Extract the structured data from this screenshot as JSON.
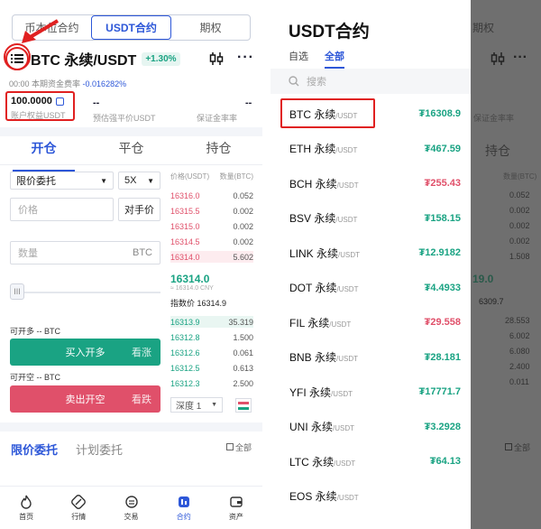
{
  "left": {
    "top_tabs": [
      "币本位合约",
      "USDT合约",
      "期权"
    ],
    "pair": "BTC 永续/USDT",
    "change_pct": "+1.30%",
    "funding_rate_prefix": "00:00 本期资金费率",
    "funding_rate_value": "-0.016282%",
    "balance_value": "100.0000",
    "balance_label": "账户权益USDT",
    "est_dash": "--",
    "est_label": "预估强平价USDT",
    "rate_dash": "--",
    "rate_label": "保证金率率",
    "trade_tabs": [
      "开仓",
      "平仓",
      "持仓"
    ],
    "order_type": "限价委托",
    "leverage": "5X",
    "price_placeholder": "价格",
    "counterparty": "对手价",
    "qty_placeholder": "数量",
    "qty_unit": "BTC",
    "slider_handle": "III",
    "can_long": "可开多 -- BTC",
    "buy_label": "买入开多",
    "buy_sub": "看涨",
    "can_short": "可开空 -- BTC",
    "sell_label": "卖出开空",
    "sell_sub": "看跌",
    "ob_head_price": "价格(USDT)",
    "ob_head_qty": "数量(BTC)",
    "asks": [
      {
        "price": "16316.0",
        "qty": "0.052"
      },
      {
        "price": "16315.5",
        "qty": "0.002"
      },
      {
        "price": "16315.0",
        "qty": "0.002"
      },
      {
        "price": "16314.5",
        "qty": "0.002"
      },
      {
        "price": "16314.0",
        "qty": "5.602"
      }
    ],
    "last_price": "16314.0",
    "last_sub": "≈ 16314.0 CNY",
    "index_price": "指数价 16314.9",
    "bids": [
      {
        "price": "16313.9",
        "qty": "35.319"
      },
      {
        "price": "16312.8",
        "qty": "1.500"
      },
      {
        "price": "16312.6",
        "qty": "0.061"
      },
      {
        "price": "16312.5",
        "qty": "0.613"
      },
      {
        "price": "16312.3",
        "qty": "2.500"
      }
    ],
    "depth": "深度 1",
    "order_tabs": [
      "限价委托",
      "计划委托"
    ],
    "all_label": "全部",
    "nav": [
      "首页",
      "行情",
      "交易",
      "合约",
      "资产"
    ]
  },
  "drawer": {
    "title": "USDT合约",
    "tabs": [
      "自选",
      "全部"
    ],
    "search_placeholder": "搜索",
    "items": [
      {
        "name": "BTC 永续",
        "quote": "/USDT",
        "price": "₮16308.9",
        "dir": "up"
      },
      {
        "name": "ETH 永续",
        "quote": "/USDT",
        "price": "₮467.59",
        "dir": "up"
      },
      {
        "name": "BCH 永续",
        "quote": "/USDT",
        "price": "₮255.43",
        "dir": "down"
      },
      {
        "name": "BSV 永续",
        "quote": "/USDT",
        "price": "₮158.15",
        "dir": "up"
      },
      {
        "name": "LINK 永续",
        "quote": "/USDT",
        "price": "₮12.9182",
        "dir": "up"
      },
      {
        "name": "DOT 永续",
        "quote": "/USDT",
        "price": "₮4.4933",
        "dir": "up"
      },
      {
        "name": "FIL 永续",
        "quote": "/USDT",
        "price": "₮29.558",
        "dir": "down"
      },
      {
        "name": "BNB 永续",
        "quote": "/USDT",
        "price": "₮28.181",
        "dir": "up"
      },
      {
        "name": "YFI 永续",
        "quote": "/USDT",
        "price": "₮17771.7",
        "dir": "up"
      },
      {
        "name": "UNI 永续",
        "quote": "/USDT",
        "price": "₮3.2928",
        "dir": "up"
      },
      {
        "name": "LTC 永续",
        "quote": "/USDT",
        "price": "₮64.13",
        "dir": "up"
      },
      {
        "name": "EOS 永续",
        "quote": "/USDT",
        "price": "",
        "dir": "up"
      }
    ]
  },
  "dim": {
    "tab": "期权",
    "rate_label": "保证金率率",
    "position": "持仓",
    "qty_head": "数量(BTC)",
    "qtys_top": [
      "0.052",
      "0.002",
      "0.002",
      "0.002",
      "1.508"
    ],
    "price_big": "19.0",
    "price_small": "6309.7",
    "qtys_bottom": [
      "28.553",
      "6.002",
      "6.080",
      "2.400",
      "0.011"
    ],
    "all_label": "全部"
  },
  "colors": {
    "accent": "#2d57d8",
    "up": "#1aa383",
    "down": "#e0506a",
    "highlight": "#e02020"
  }
}
